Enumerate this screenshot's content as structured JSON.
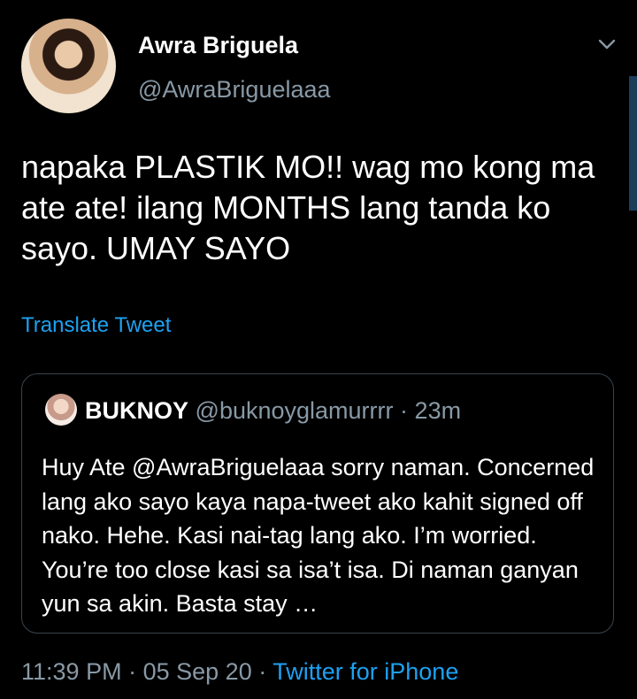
{
  "tweet": {
    "author_name": "Awra Briguela",
    "author_handle": "@AwraBriguelaaa",
    "text": "napaka PLASTIK MO!! wag mo kong ma ate ate! ilang MONTHS lang tanda ko sayo. UMAY SAYO",
    "translate_label": "Translate Tweet",
    "time": "11:39 PM",
    "separator": "·",
    "date": "05 Sep 20",
    "source": "Twitter for iPhone"
  },
  "quote": {
    "name": "BUKNOY",
    "handle": "@buknoyglamurrrr",
    "separator": "·",
    "time": "23m",
    "text": "Huy Ate @AwraBriguelaaa sorry naman. Concerned lang ako sayo kaya napa-tweet ako kahit signed off nako. Hehe. Kasi nai-tag lang ako. I’m worried. You’re too close kasi sa isa’t isa. Di naman ganyan yun sa akin. Basta stay …"
  },
  "icons": {
    "caret": "chevron-down-icon"
  },
  "colors": {
    "background": "#000000",
    "muted": "#8899a6",
    "accent": "#1da1f2",
    "border": "#38444d"
  }
}
